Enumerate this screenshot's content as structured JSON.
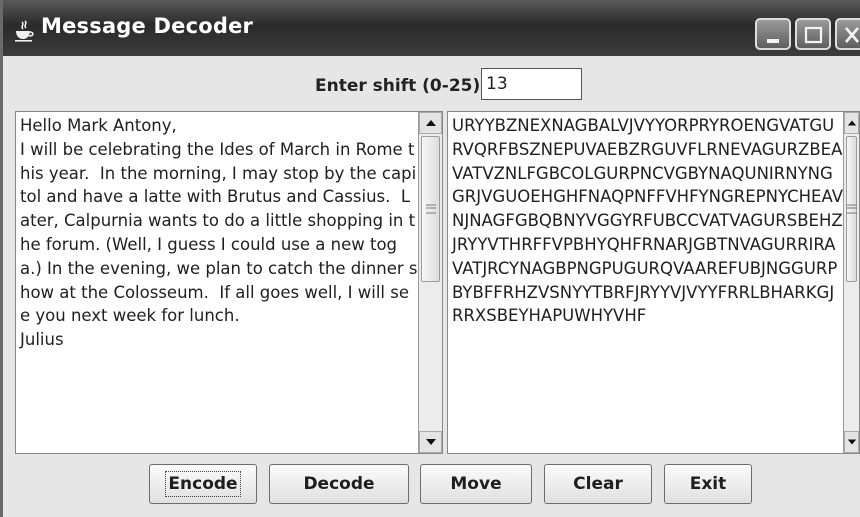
{
  "window": {
    "title": "Message Decoder",
    "icon": "java-cup-icon"
  },
  "shift": {
    "label": "Enter shift (0-25)",
    "value": "13"
  },
  "plaintext": "Hello Mark Antony,\nI will be celebrating the Ides of March in Rome this year.  In the morning, I may stop by the capitol and have a latte with Brutus and Cassius.  Later, Calpurnia wants to do a little shopping in the forum. (Well, I guess I could use a new toga.) In the evening, we plan to catch the dinner show at the Colosseum.  If all goes well, I will see you next week for lunch.\nJulius",
  "ciphertext": "URYYBZNEXNAGBALVJVYYORPRYROENGVATGURVQRFBSZNEPUVAEBZRGUVFLRNEVAGURZBEAVATVZNLFGBCOLGURPNCVGBYNAQUNIRNYNGGRJVGUOEHGHFNAQPNFFVHFYNGREPNYCHEAVNJNAGFGBQBNYVGGYRFUBCCVATVAGURSBEHZJRYYVTHRFFVPBHYQHFRNARJGBTNVAGURRIRAVATJRCYNAGBPNGPUGURQVAAREFUBJNGGURPBYBFFRHZVSNYYTBRFJRYYVJVYYFRRLBHARKGJRRXSBEYHAPUWHYVHF",
  "buttons": {
    "encode": "Encode",
    "decode": "Decode",
    "move": "Move",
    "clear": "Clear",
    "exit": "Exit"
  }
}
